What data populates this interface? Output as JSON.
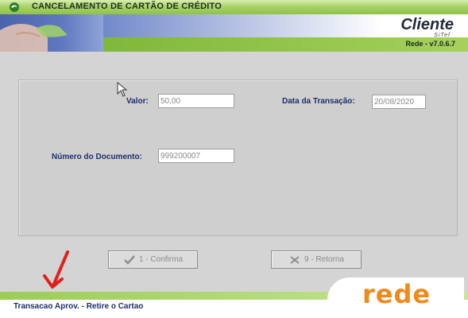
{
  "window": {
    "title": "CANCELAMENTO DE CARTÃO DE CRÉDITO",
    "icon": "app-swirl-icon"
  },
  "banner": {
    "brand": "Cliente",
    "brand_sub": "SiTef",
    "version": "Rede - v7.0.6.7"
  },
  "form": {
    "valor": {
      "label": "Valor:",
      "value": "50,00"
    },
    "data_transacao": {
      "label": "Data da Transação:",
      "value": "20/08/2020"
    },
    "numero_documento": {
      "label": "Número do Documento:",
      "value": "999200007"
    }
  },
  "buttons": {
    "confirma": {
      "key": "1",
      "label": "1 - Confirma",
      "icon": "checkmark-icon"
    },
    "retorna": {
      "key": "9",
      "label": "9 - Retorna",
      "icon": "return-icon"
    }
  },
  "status": {
    "message": "Transacao Aprov. - Retire o Cartao"
  },
  "logo": {
    "text": "rede"
  },
  "colors": {
    "title_green": "#a9d36a",
    "label_navy": "#1f2d6b",
    "logo_orange": "#f08a1c",
    "annotation_red": "#e0201a"
  }
}
